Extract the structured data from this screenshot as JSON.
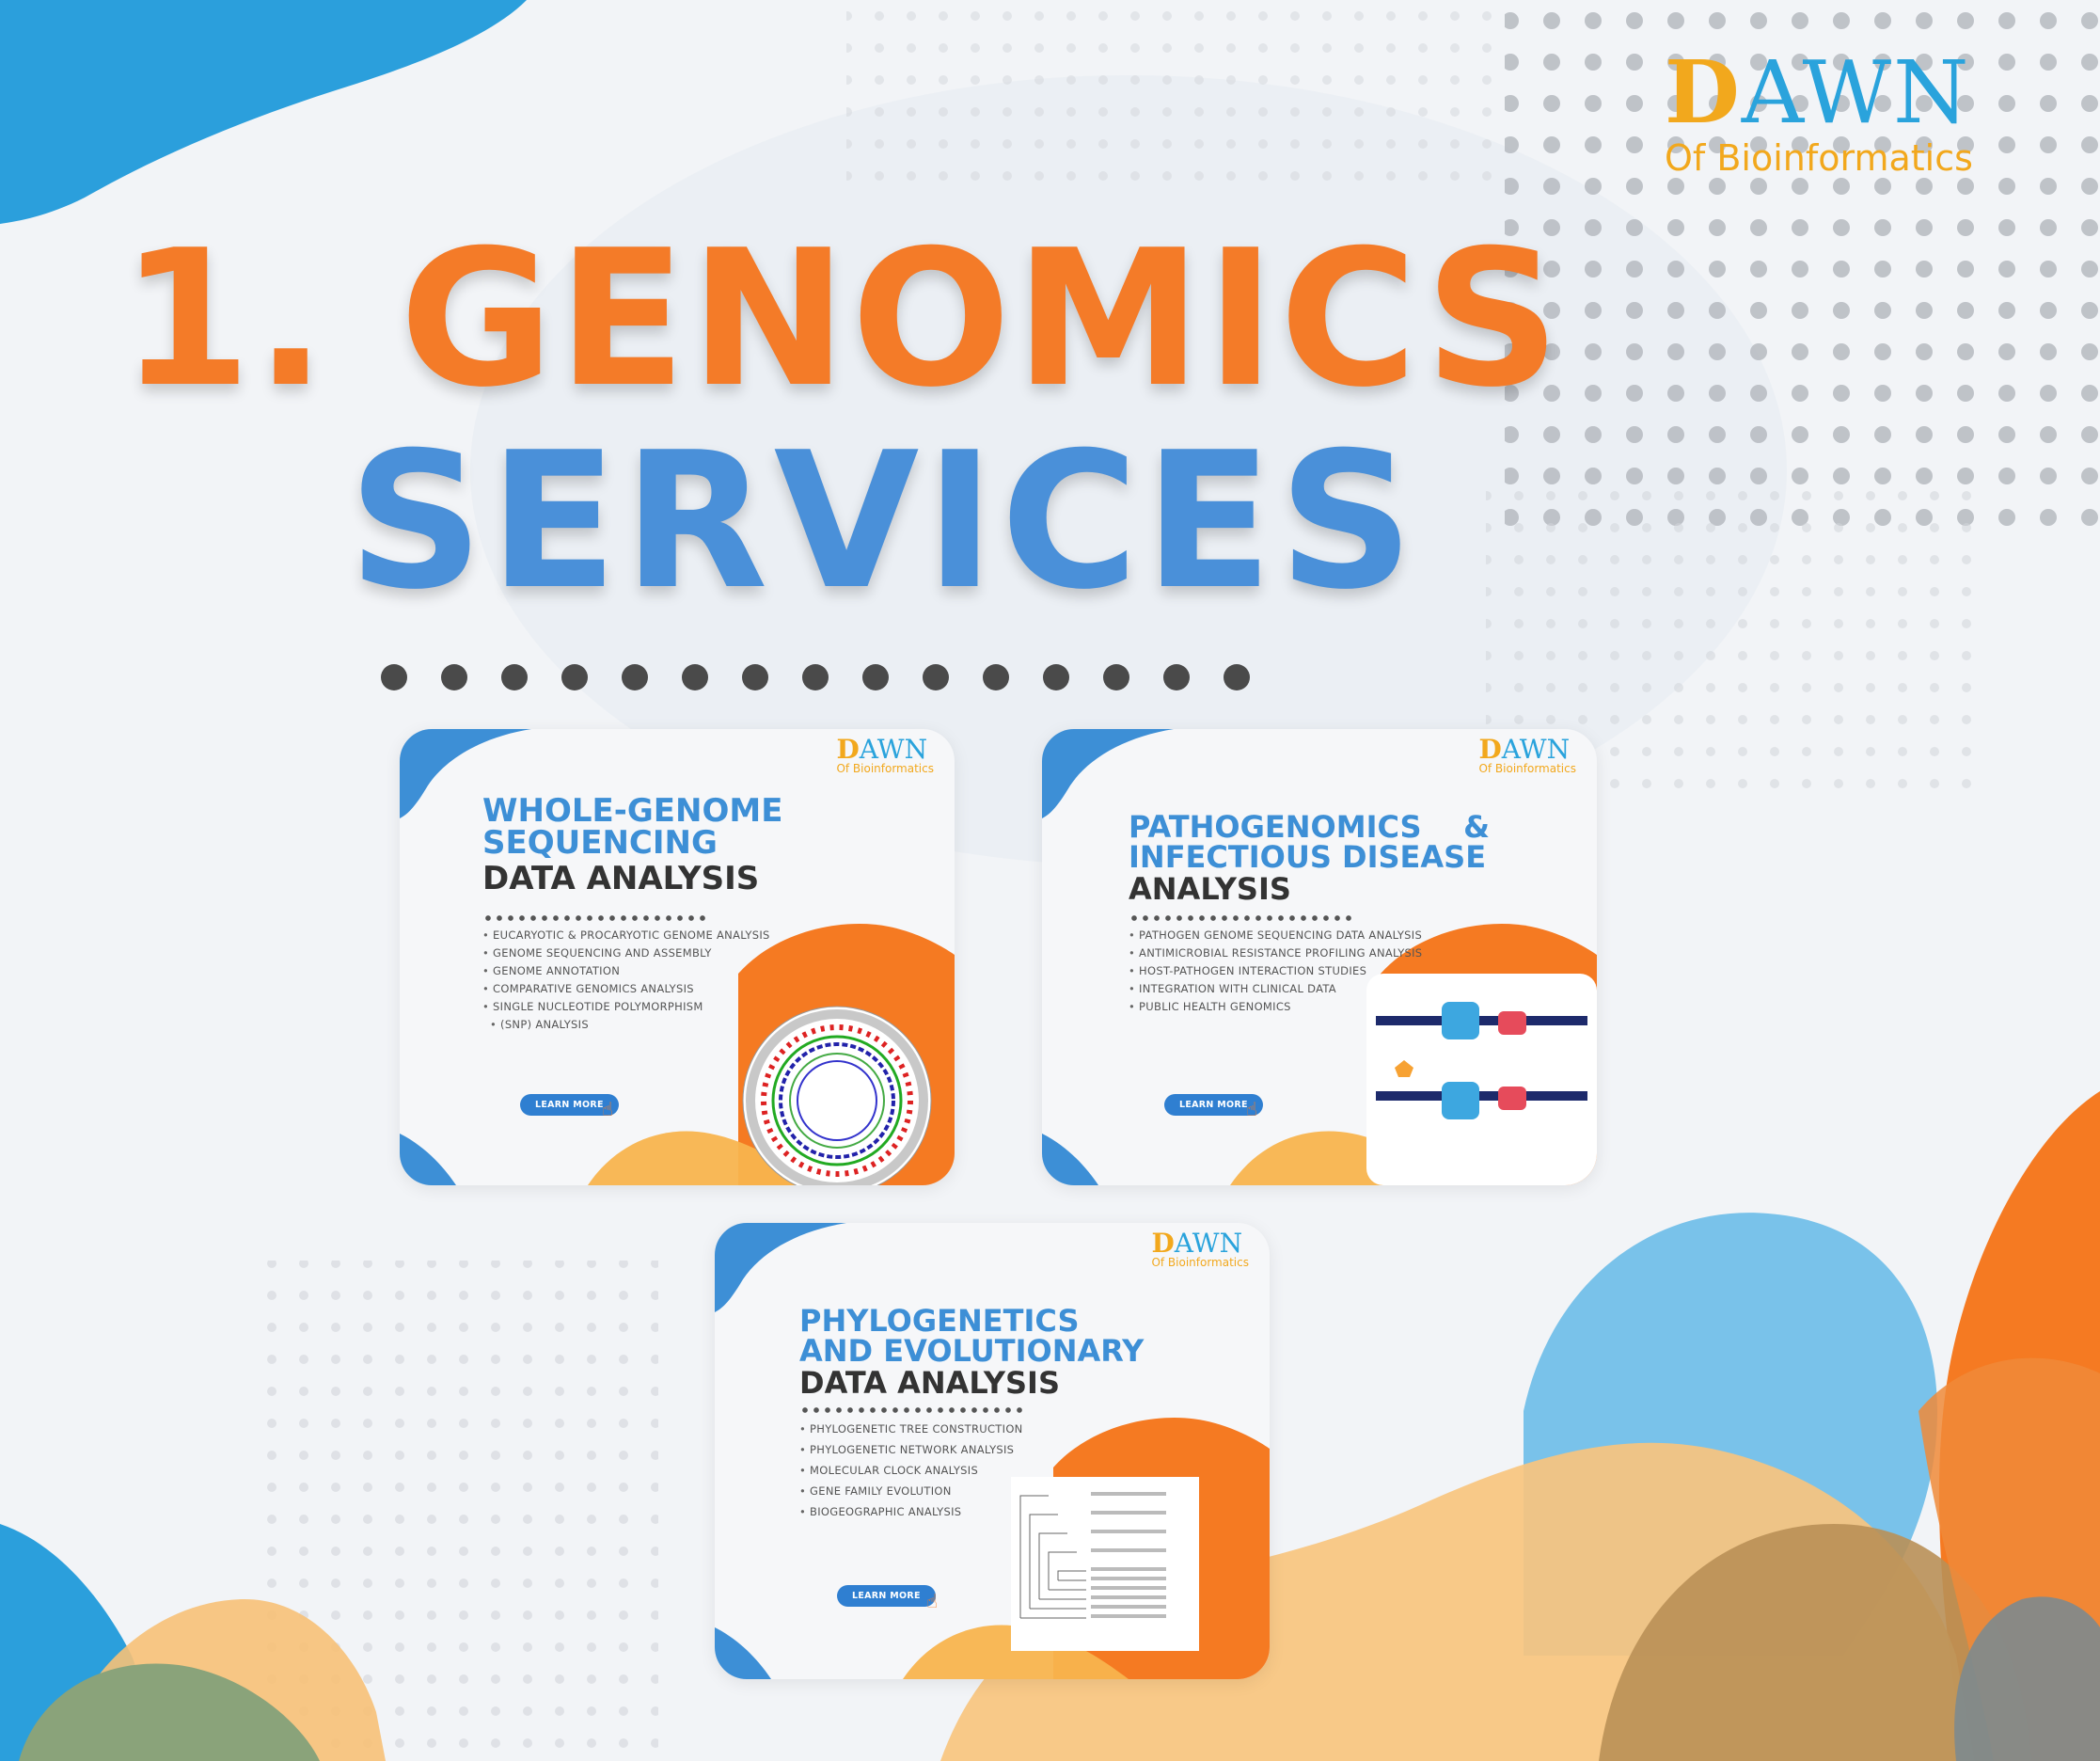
{
  "brand": {
    "logo_word": "AWN",
    "logo_sub": "Of Bioinformatics"
  },
  "headline": {
    "line1": "1. GENOMICS",
    "line2": "SERVICES"
  },
  "colors": {
    "orange": "#f47b28",
    "blue": "#4a90d9",
    "dark_text": "#333333",
    "button_blue": "#2f7fd1",
    "peach": "#f7b84a",
    "sky": "#5ab8e8"
  },
  "cards": [
    {
      "title_blue_1": "WHOLE-GENOME",
      "title_blue_2": "SEQUENCING",
      "title_dark": "DATA ANALYSIS",
      "items": [
        "EUCARYOTIC & PROCARYOTIC GENOME ANALYSIS",
        "GENOME SEQUENCING AND ASSEMBLY",
        "GENOME ANNOTATION",
        "COMPARATIVE GENOMICS ANALYSIS",
        "SINGLE NUCLEOTIDE POLYMORPHISM",
        "(SNP) ANALYSIS"
      ],
      "button": "LEARN MORE",
      "figure_icon": "circular-genome-map"
    },
    {
      "title_blue_1": "PATHOGENOMICS    &",
      "title_blue_2": "INFECTIOUS DISEASE",
      "title_dark": "ANALYSIS",
      "items": [
        "PATHOGEN GENOME SEQUENCING DATA ANALYSIS",
        "ANTIMICROBIAL RESISTANCE PROFILING ANALYSIS",
        "HOST-PATHOGEN INTERACTION STUDIES",
        "INTEGRATION WITH CLINICAL DATA",
        "PUBLIC HEALTH GENOMICS"
      ],
      "button": "LEARN MORE",
      "figure_icon": "pathway-diagram"
    },
    {
      "title_blue_1": "PHYLOGENETICS",
      "title_blue_2": "AND EVOLUTIONARY",
      "title_dark": "DATA ANALYSIS",
      "items": [
        "PHYLOGENETIC TREE CONSTRUCTION",
        "PHYLOGENETIC NETWORK ANALYSIS",
        "MOLECULAR CLOCK ANALYSIS",
        "GENE FAMILY EVOLUTION",
        "BIOGEOGRAPHIC ANALYSIS"
      ],
      "button": "LEARN MORE",
      "figure_icon": "phylogenetic-tree"
    }
  ]
}
